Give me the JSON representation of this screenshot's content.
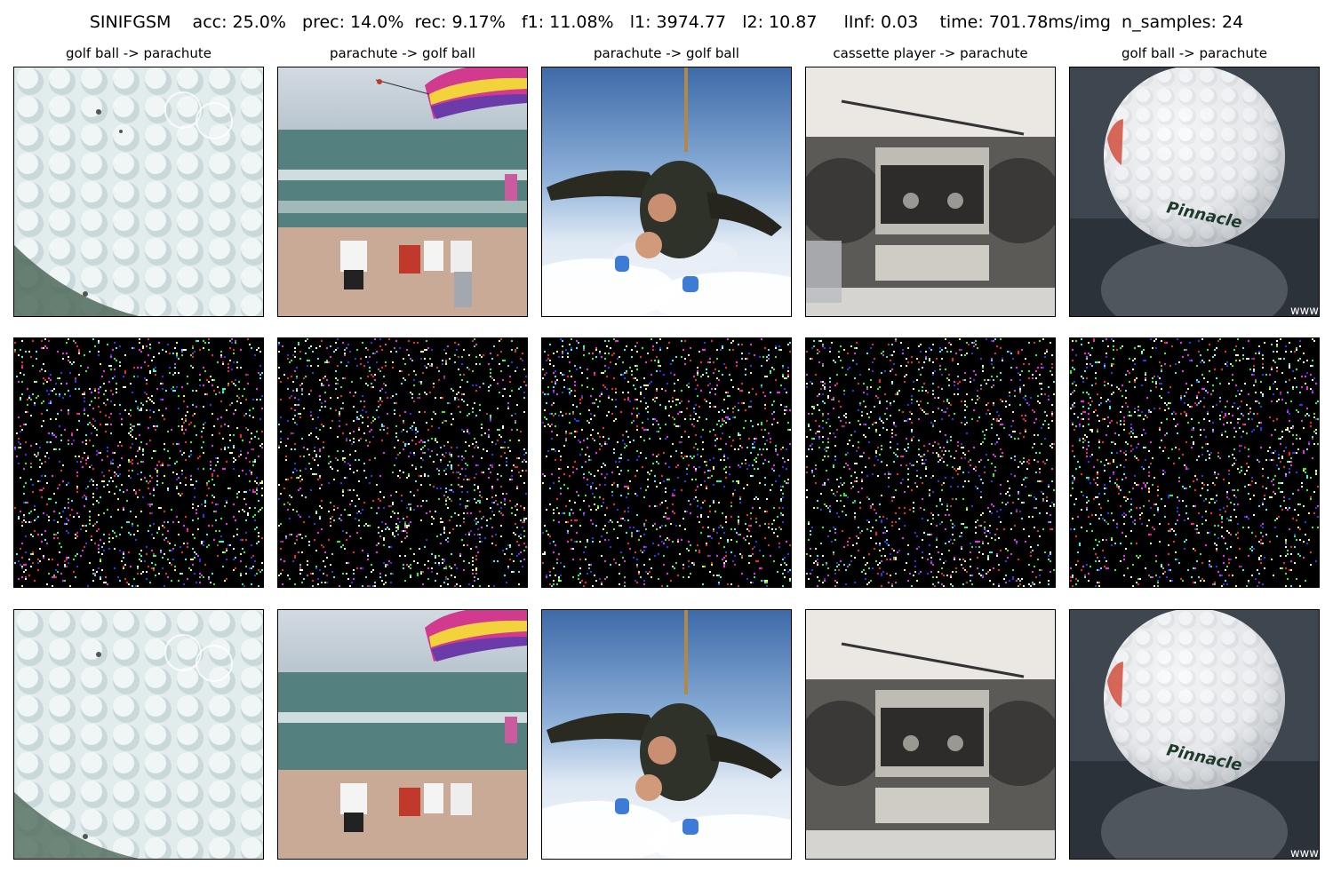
{
  "figure": {
    "suptitle": "SINIFGSM    acc: 25.0%   prec: 14.0%  rec: 9.17%   f1: 11.08%   l1: 3974.77   l2: 10.87     lInf: 0.03    time: 701.78ms/img  n_samples: 24"
  },
  "columns": [
    {
      "title": "golf ball -> parachute",
      "image": "golf-ball-closeup"
    },
    {
      "title": "parachute -> golf ball",
      "image": "beach-parasail"
    },
    {
      "title": "parachute -> golf ball",
      "image": "tandem-skydivers"
    },
    {
      "title": "cassette player -> parachute",
      "image": "boombox"
    },
    {
      "title": "golf ball -> parachute",
      "image": "pinnacle-golf-ball"
    }
  ],
  "rows": [
    "original",
    "perturbation",
    "adversarial"
  ],
  "texts_in_images": {
    "golf_ball_brand": "Pinnacle",
    "watermark": "www."
  }
}
